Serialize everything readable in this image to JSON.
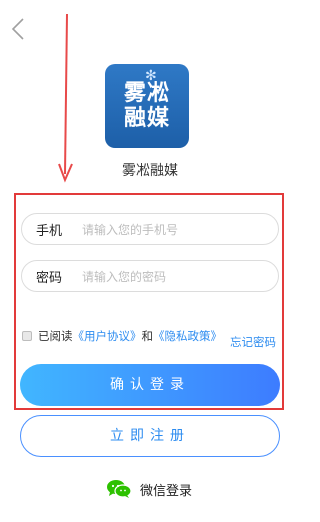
{
  "nav": {
    "back_icon": "chevron-left-icon",
    "back_glyph": "‹"
  },
  "logo": {
    "line1": "雾凇",
    "line2": "融媒",
    "snow": "✻"
  },
  "app_name": "雾凇融媒",
  "phone": {
    "label": "手机",
    "placeholder": "请输入您的手机号"
  },
  "password": {
    "label": "密码",
    "placeholder": "请输入您的密码"
  },
  "agreement": {
    "prefix": "已阅读",
    "user_agreement": "《用户协议》",
    "and": "和",
    "privacy_policy": "《隐私政策》"
  },
  "forgot_password": "忘记密码",
  "login_button": "确认登录",
  "register_button": "立即注册",
  "wechat_login": "微信登录",
  "colors": {
    "annotation_red": "#e23a3a",
    "link_blue": "#2d8cf0",
    "wechat_green": "#2dc100"
  }
}
